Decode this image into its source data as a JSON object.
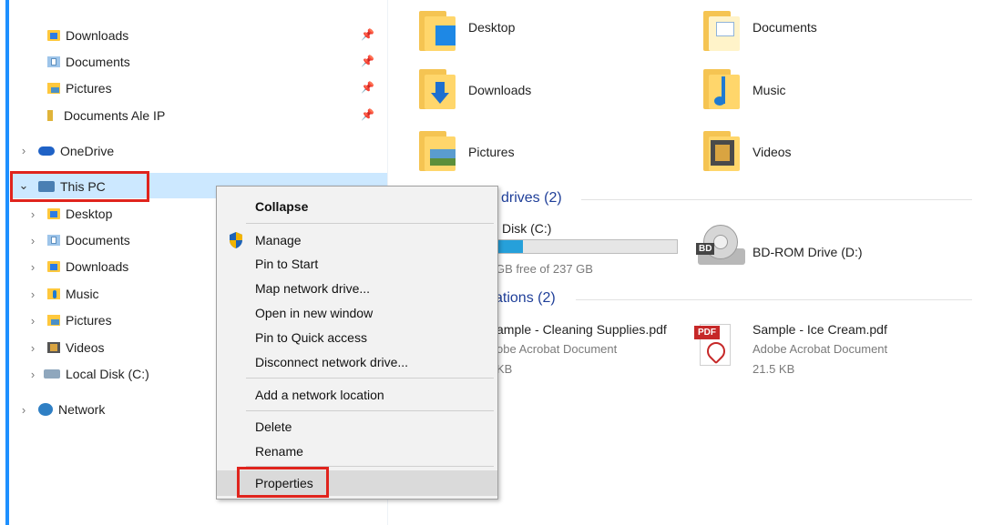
{
  "nav": {
    "quick_access": [
      {
        "label": "Downloads",
        "icon": "downloads-folder-icon",
        "pinned": true
      },
      {
        "label": "Documents",
        "icon": "documents-folder-icon",
        "pinned": true
      },
      {
        "label": "Pictures",
        "icon": "pictures-folder-icon",
        "pinned": true
      },
      {
        "label": "Documents Ale IP",
        "icon": "folder-icon",
        "pinned": true
      }
    ],
    "onedrive": "OneDrive",
    "this_pc": "This PC",
    "this_pc_children": [
      {
        "label": "Desktop",
        "icon": "desktop-folder-icon"
      },
      {
        "label": "Documents",
        "icon": "documents-folder-icon"
      },
      {
        "label": "Downloads",
        "icon": "downloads-folder-icon"
      },
      {
        "label": "Music",
        "icon": "music-folder-icon"
      },
      {
        "label": "Pictures",
        "icon": "pictures-folder-icon"
      },
      {
        "label": "Videos",
        "icon": "videos-folder-icon"
      },
      {
        "label": "Local Disk (C:)",
        "icon": "local-disk-icon"
      }
    ],
    "network": "Network",
    "pin_glyph": "📌"
  },
  "main": {
    "folders": [
      {
        "label": "Desktop"
      },
      {
        "label": "Documents"
      },
      {
        "label": "Downloads"
      },
      {
        "label": "Music"
      },
      {
        "label": "Pictures"
      },
      {
        "label": "Videos"
      }
    ],
    "drives_group": "drives (2)",
    "drive_c": {
      "name": "Disk (C:)",
      "free": "GB free of 237 GB",
      "used_fraction": 0.25
    },
    "drive_d": {
      "name": "BD-ROM Drive (D:)"
    },
    "locations_group": "ations (2)",
    "files": [
      {
        "name": "ample - Cleaning Supplies.pdf",
        "type": "obe Acrobat Document",
        "size": "KB"
      },
      {
        "name": "Sample - Ice Cream.pdf",
        "type": "Adobe Acrobat Document",
        "size": "21.5 KB"
      }
    ],
    "pdf_badge": "PDF",
    "bd_badge": "BD"
  },
  "context_menu": {
    "items": [
      {
        "label": "Collapse",
        "bold": true
      },
      {
        "label": "Manage",
        "icon": "shield-icon"
      },
      {
        "label": "Pin to Start"
      },
      {
        "label": "Map network drive..."
      },
      {
        "label": "Open in new window"
      },
      {
        "label": "Pin to Quick access"
      },
      {
        "label": "Disconnect network drive..."
      },
      {
        "label": "Add a network location"
      },
      {
        "label": "Delete"
      },
      {
        "label": "Rename"
      },
      {
        "label": "Properties",
        "highlighted": true
      }
    ]
  },
  "colors": {
    "selection": "#cce8ff",
    "highlight_box": "#e0241d",
    "group_title": "#1f3f99",
    "drive_fill": "#26a0da"
  }
}
